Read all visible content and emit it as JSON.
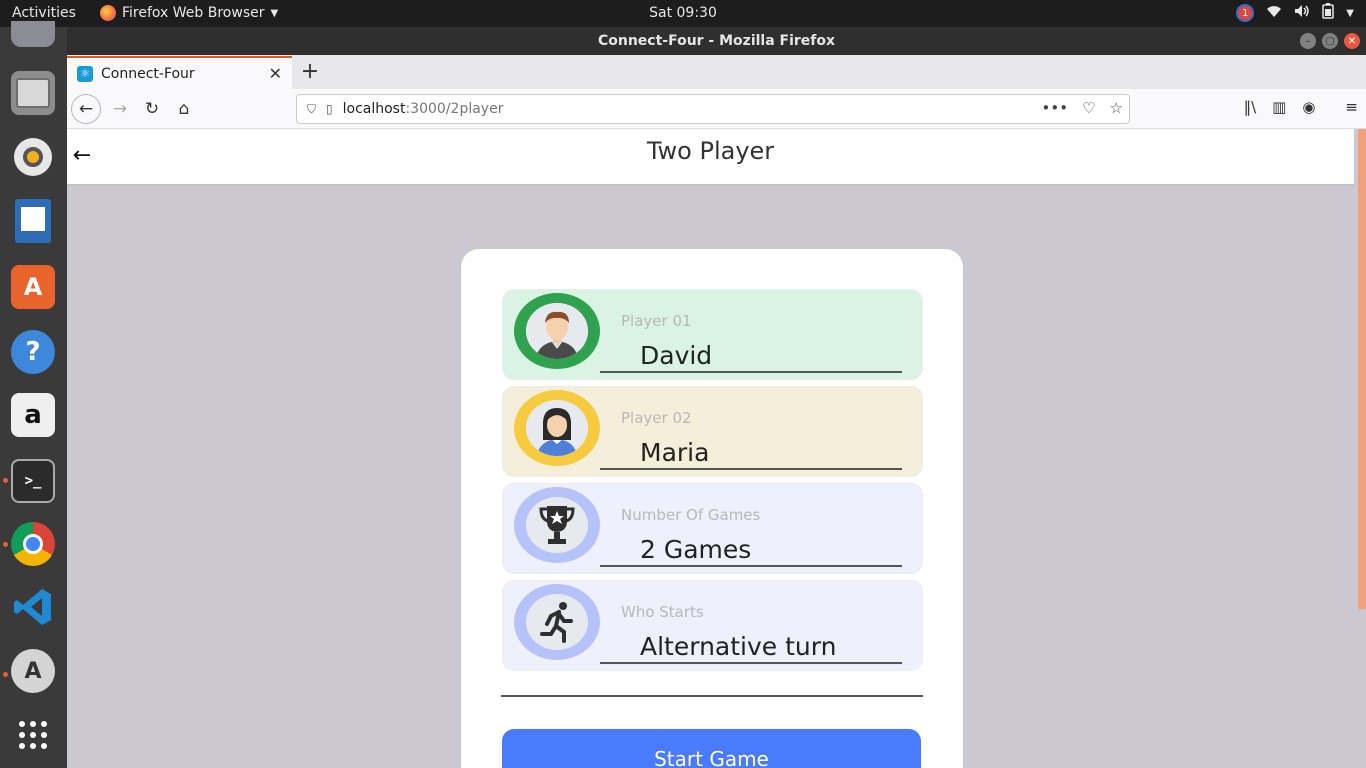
{
  "topbar": {
    "activities": "Activities",
    "app_name": "Firefox Web Browser",
    "clock": "Sat 09:30",
    "notification_count": "1"
  },
  "window": {
    "title": "Connect-Four - Mozilla Firefox"
  },
  "tab": {
    "label": "Connect-Four"
  },
  "urlbar": {
    "host": "localhost",
    "path": ":3000/2player"
  },
  "app": {
    "header_title": "Two Player",
    "rows": [
      {
        "label": "Player 01",
        "value": "David",
        "ring_color": "#2fa14f",
        "bg": "#d9f4e3"
      },
      {
        "label": "Player 02",
        "value": "Maria",
        "ring_color": "#f7cb3f",
        "bg": "#f5eed9"
      },
      {
        "label": "Number Of Games",
        "value": "2 Games",
        "ring_color": "#b6c3fa",
        "bg": "#eef1fc"
      },
      {
        "label": "Who Starts",
        "value": "Alternative turn",
        "ring_color": "#b6c3fa",
        "bg": "#eef1fc"
      }
    ],
    "start_button": "Start Game",
    "accent": "#4a7bfc"
  }
}
